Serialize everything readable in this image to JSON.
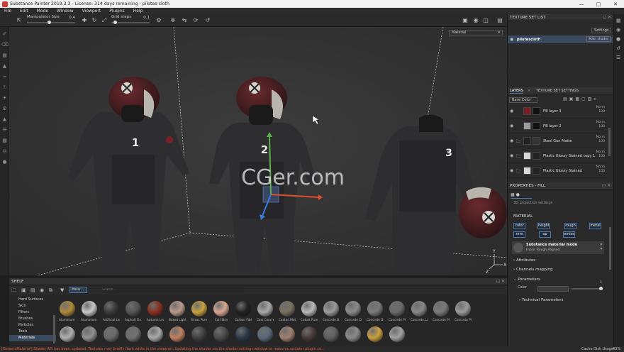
{
  "window": {
    "title": "Substance Painter 2019.3.3 - License: 314 days remaining - pilotes-cloth"
  },
  "menu": [
    "File",
    "Edit",
    "Mode",
    "Window",
    "Viewport",
    "Plugins",
    "Help"
  ],
  "toolbar": {
    "manipulator_label": "Manipulator Size",
    "manipulator_value": "0.4",
    "manipulator_fraction": 0.45,
    "grid_label": "Grid steps",
    "grid_value": "0.1",
    "grid_fraction": 0.1
  },
  "viewport": {
    "display_mode": "Material",
    "watermark": "CGer.com",
    "suit_numbers": [
      "1",
      "2",
      "3"
    ]
  },
  "texture_set_list": {
    "title": "TEXTURE SET LIST",
    "settings_label": "Settings",
    "set_name": "pilotescloth",
    "shader": "Main shader"
  },
  "layers": {
    "tab_layers": "LAYERS",
    "tab_settings": "TEXTURE SET SETTINGS",
    "channel": "Base Color",
    "items": [
      {
        "name": "Fill layer 3",
        "blend": "Norm",
        "opacity": "100",
        "color": "#7a1e22",
        "mask": "#111111"
      },
      {
        "name": "Fill layer 2",
        "blend": "Norm",
        "opacity": "100",
        "color": "#9a9a9a",
        "mask": "#111111"
      },
      {
        "name": "Steel Gun Matte",
        "blend": "Norm",
        "opacity": "100",
        "color": "#222222",
        "mask": "#333333"
      },
      {
        "name": "Plastic Glossy Stained copy 1",
        "blend": "Norm",
        "opacity": "100",
        "color": "#d8d8d8",
        "mask": "#222222"
      },
      {
        "name": "Plastic Glossy Stained",
        "blend": "Norm",
        "opacity": "100",
        "color": "#d8d8d8",
        "mask": "#222222"
      }
    ]
  },
  "properties": {
    "title": "PROPERTIES - FILL",
    "partial_text": "3D projection settings",
    "material_header": "MATERIAL",
    "channels": [
      "color",
      "height",
      "rough",
      "metal",
      "nrm",
      "op",
      "emiss"
    ],
    "material_mode_title": "Substance material mode",
    "material_mode_value": "Fabric Rough Aligned",
    "attributes": "Attributes",
    "channels_mapping": "Channels mapping",
    "parameters": "Parameters",
    "color_label": "Color",
    "color_value": "1",
    "technical": "Technical Parameters"
  },
  "shelf": {
    "title": "SHELF",
    "filter_tag": "Mater...",
    "search_placeholder": "Search...",
    "categories": [
      "Hard Surfaces",
      "Skin",
      "Filters",
      "Brushes",
      "Particles",
      "Tools",
      "Materials"
    ],
    "active_category": "Materials",
    "materials": [
      {
        "name": "Aluminium ...",
        "color": "#b08a3a"
      },
      {
        "name": "Aluminium ...",
        "color": "#c8c8c8"
      },
      {
        "name": "Artificial Lea...",
        "color": "#3a3a3a"
      },
      {
        "name": "Asphalt Fin...",
        "color": "#555555"
      },
      {
        "name": "Autumn Leaf",
        "color": "#8a3020"
      },
      {
        "name": "Baked Light...",
        "color": "#b89a8a"
      },
      {
        "name": "Brass Pure",
        "color": "#c8a040"
      },
      {
        "name": "Calf Skin",
        "color": "#d8a890"
      },
      {
        "name": "Carbon Fiber",
        "color": "#222222"
      },
      {
        "name": "Cast Concre...",
        "color": "#a8a8a8"
      },
      {
        "name": "Coated Metal",
        "color": "#7a7060"
      },
      {
        "name": "Cobalt Pure",
        "color": "#b8b8b8"
      },
      {
        "name": "Concrete B...",
        "color": "#9a9a9a"
      },
      {
        "name": "Concrete Cl...",
        "color": "#8a8a8a"
      },
      {
        "name": "Concrete D...",
        "color": "#7a7a7a"
      },
      {
        "name": "Concrete Pl...",
        "color": "#6a6a6a"
      },
      {
        "name": "Concrete La...",
        "color": "#888888"
      },
      {
        "name": "Concrete Pl...",
        "color": "#7a7a7a"
      },
      {
        "name": "Concrete Pl...",
        "color": "#9a9a9a"
      }
    ],
    "row2_colors": [
      "#b0b0b0",
      "#909090",
      "#6a6a6a",
      "#707070",
      "#a8a8a8",
      "#c08060",
      "#404040",
      "#4a4a4a",
      "#2a3a4a",
      "#5a6a7a",
      "#a08070",
      "#4a3a3a",
      "#606060",
      "#8a8a8a",
      "#c8a040",
      "#a0a0a0"
    ]
  },
  "status": {
    "message": "[GenericMaterial] Shader API has been updated. Textures may briefly flash white in the viewport. Updating the shader via the shader settings window or resource updater plugin co...",
    "cache_label": "Cache Disk Usage:",
    "cache_value": "43%"
  },
  "colors": {
    "accent": "#4a78b0",
    "gizmo_x": "#e0502a",
    "gizmo_y": "#5ab04a",
    "gizmo_z": "#3a7ae0",
    "error_text": "#e05a3a"
  }
}
